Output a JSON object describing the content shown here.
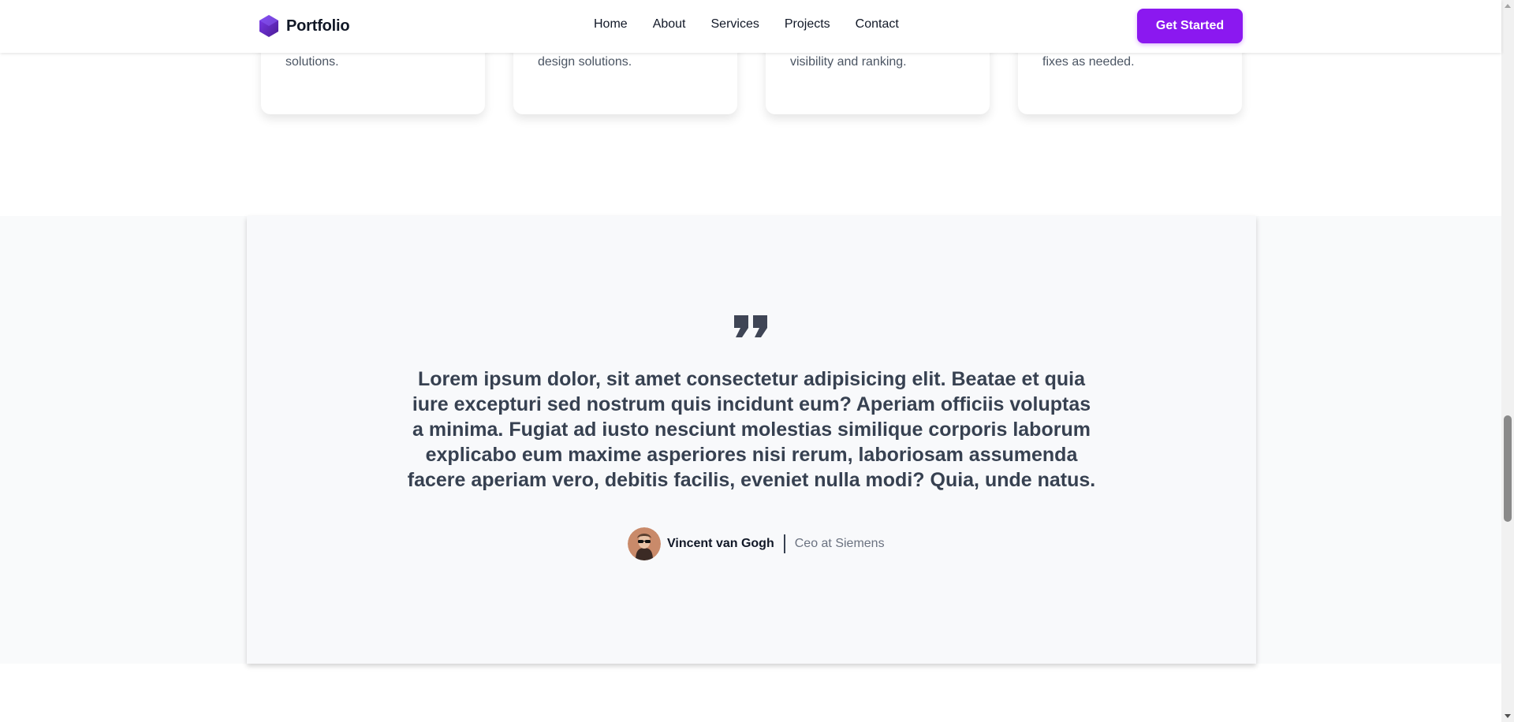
{
  "brand": {
    "name": "Portfolio",
    "logo_icon": "hexagon-logo-icon",
    "accent_color": "#8b18f0"
  },
  "nav": {
    "links": [
      "Home",
      "About",
      "Services",
      "Projects",
      "Contact"
    ],
    "cta_label": "Get Started"
  },
  "services": {
    "cards": [
      {
        "text": "solutions."
      },
      {
        "text": "design solutions."
      },
      {
        "text": "visibility and ranking."
      },
      {
        "text": "fixes as needed."
      }
    ]
  },
  "testimonial": {
    "quote_icon": "quote-icon",
    "quote": "Lorem ipsum dolor, sit amet consectetur adipisicing elit. Beatae et quia iure excepturi sed nostrum quis incidunt eum? Aperiam officiis voluptas a minima. Fugiat ad iusto nesciunt molestias similique corporis laborum explicabo eum maxime asperiores nisi rerum, laboriosam assumenda facere aperiam vero, debitis facilis, eveniet nulla modi? Quia, unde natus.",
    "author_name": "Vincent van Gogh",
    "author_role": "Ceo at Siemens",
    "avatar_icon": "avatar-icon"
  }
}
